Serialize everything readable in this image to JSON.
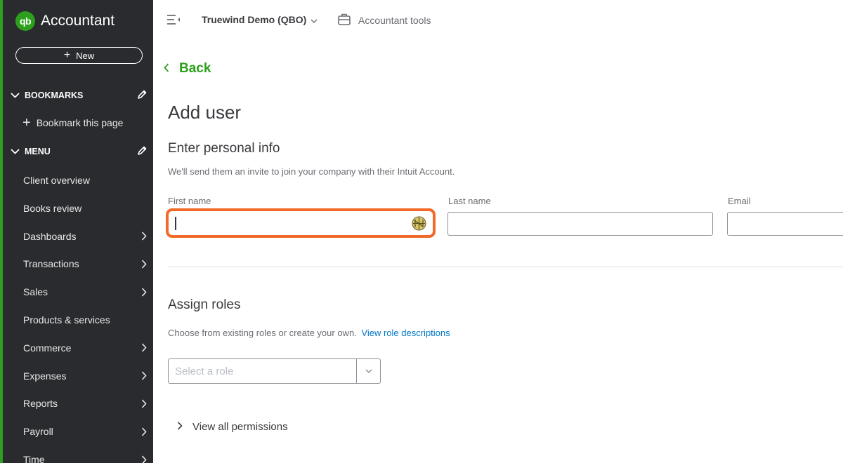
{
  "sidebar": {
    "logo_mark": "qb",
    "app_name": "Accountant",
    "new_label": "New",
    "bookmarks_heading": "BOOKMARKS",
    "bookmark_this_page": "Bookmark this page",
    "menu_heading": "MENU",
    "items": [
      {
        "label": "Client overview",
        "has_arrow": false
      },
      {
        "label": "Books review",
        "has_arrow": false
      },
      {
        "label": "Dashboards",
        "has_arrow": true
      },
      {
        "label": "Transactions",
        "has_arrow": true
      },
      {
        "label": "Sales",
        "has_arrow": true
      },
      {
        "label": "Products & services",
        "has_arrow": false
      },
      {
        "label": "Commerce",
        "has_arrow": true
      },
      {
        "label": "Expenses",
        "has_arrow": true
      },
      {
        "label": "Reports",
        "has_arrow": true
      },
      {
        "label": "Payroll",
        "has_arrow": true
      },
      {
        "label": "Time",
        "has_arrow": true
      }
    ]
  },
  "topbar": {
    "company_name": "Truewind Demo (QBO)",
    "accountant_tools": "Accountant tools"
  },
  "main": {
    "back_label": "Back",
    "page_title": "Add user",
    "personal_info_title": "Enter personal info",
    "personal_info_desc": "We'll send them an invite to join your company with their Intuit Account.",
    "first_name_label": "First name",
    "first_name_value": "",
    "last_name_label": "Last name",
    "last_name_value": "",
    "email_label": "Email",
    "email_value": "",
    "assign_roles_title": "Assign roles",
    "assign_roles_desc": "Choose from existing roles or create your own.",
    "role_descriptions_link": "View role descriptions",
    "role_placeholder": "Select a role",
    "view_permissions": "View all permissions"
  },
  "colors": {
    "brand_green": "#2ca01c",
    "sidebar_bg": "#2a2b2e",
    "highlight_orange": "#f26a2a",
    "link_blue": "#0077c5"
  },
  "icons": [
    "qb-logo-icon",
    "plus-icon",
    "chevron-down-icon",
    "pencil-icon",
    "chevron-right-icon",
    "menu-collapse-icon",
    "briefcase-icon",
    "chevron-left-icon",
    "autofill-key-icon"
  ]
}
